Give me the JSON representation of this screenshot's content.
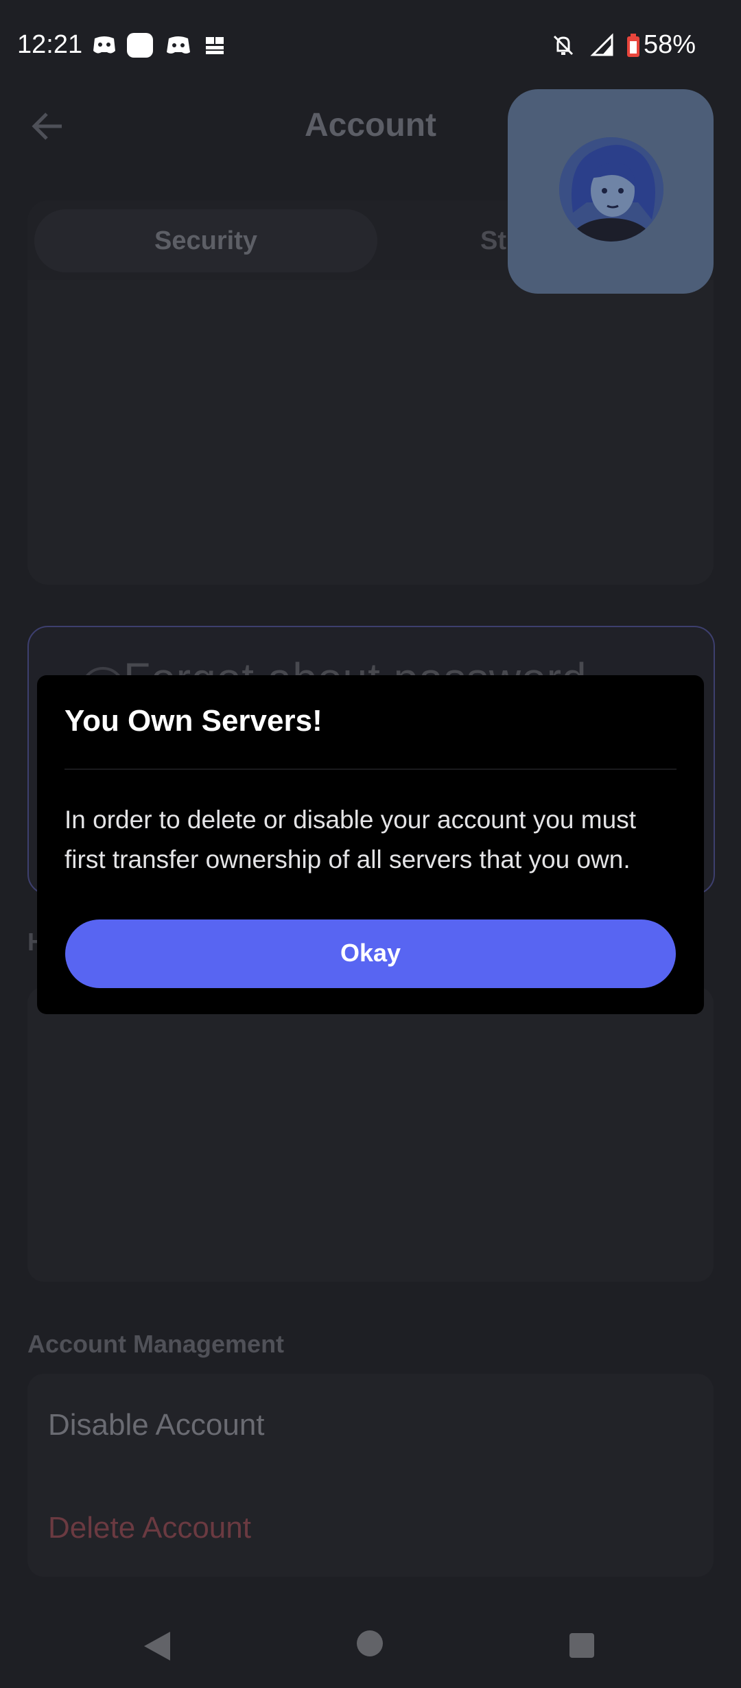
{
  "status_bar": {
    "time": "12:21",
    "battery": "58%",
    "icons": [
      "discord-helper-icon",
      "white-square-icon",
      "discord-icon",
      "news-icon",
      "notifications-off-icon",
      "signal-icon",
      "battery-icon"
    ]
  },
  "header": {
    "title": "Account",
    "back_icon": "arrow-left-icon"
  },
  "tabs": [
    {
      "label": "Security",
      "selected": true
    },
    {
      "label": "St",
      "selected": false
    }
  ],
  "passkey_card": {
    "partial_text": "Forgot about password"
  },
  "hidden_section": {
    "partial_label": "H"
  },
  "account_management": {
    "section_label": "Account Management",
    "items": [
      {
        "label": "Disable Account"
      },
      {
        "label": "Delete Account"
      }
    ]
  },
  "dialog": {
    "title": "You Own Servers!",
    "body": "In order to delete or disable your account you must first transfer ownership of all servers that you own.",
    "button_label": "Okay"
  },
  "colors": {
    "accent": "#5865f2",
    "danger": "#6b3a41",
    "background": "#1e1f24",
    "bubble": "#4d5e78"
  },
  "nav_bar": {
    "icons": [
      "back-triangle-icon",
      "home-circle-icon",
      "recents-square-icon"
    ]
  }
}
